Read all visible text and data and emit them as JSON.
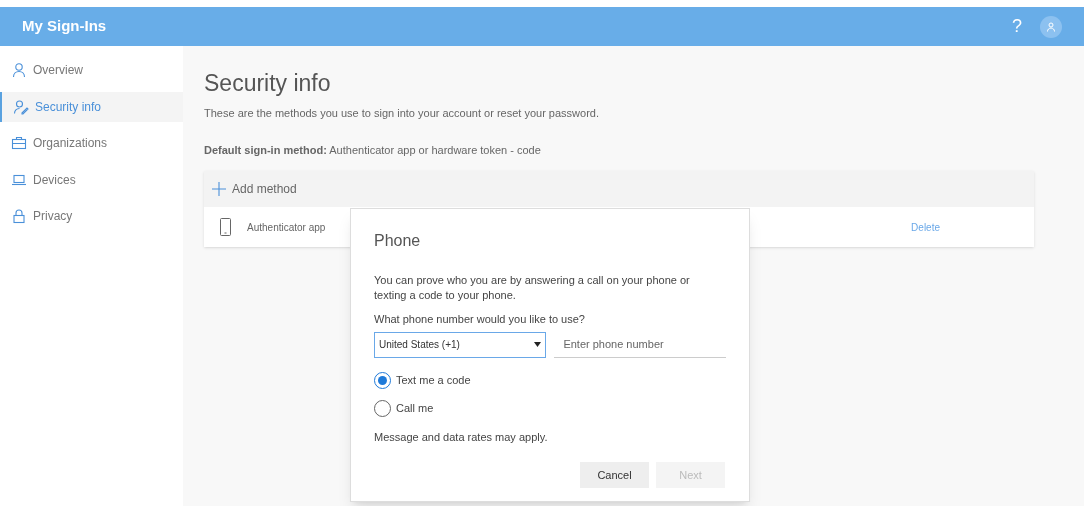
{
  "header": {
    "title": "My Sign-Ins",
    "help": "?"
  },
  "sidebar": {
    "items": [
      {
        "label": "Overview",
        "selected": false
      },
      {
        "label": "Security info",
        "selected": true
      },
      {
        "label": "Organizations",
        "selected": false
      },
      {
        "label": "Devices",
        "selected": false
      },
      {
        "label": "Privacy",
        "selected": false
      }
    ]
  },
  "main": {
    "title": "Security info",
    "subtitle": "These are the methods you use to sign into your account or reset your password.",
    "default_method": "**Default sign-in method:** Authenticator app or hardware token - code",
    "add_method": "Add method",
    "methods": [
      {
        "name": "Authenticator app",
        "action": "Delete"
      }
    ]
  },
  "dialog": {
    "title": "Phone",
    "description": "You can prove who you are by answering a call on your phone or texting a code to your phone.",
    "question": "What phone number would you like to use?",
    "country": "United States (+1)",
    "phone_placeholder": "Enter phone number",
    "options": [
      {
        "label": "Text me a code",
        "selected": true
      },
      {
        "label": "Call me",
        "selected": false
      }
    ],
    "note": "Message and data rates may apply.",
    "buttons": [
      {
        "label": "Cancel",
        "disabled": false
      },
      {
        "label": "Next",
        "disabled": true
      }
    ]
  }
}
